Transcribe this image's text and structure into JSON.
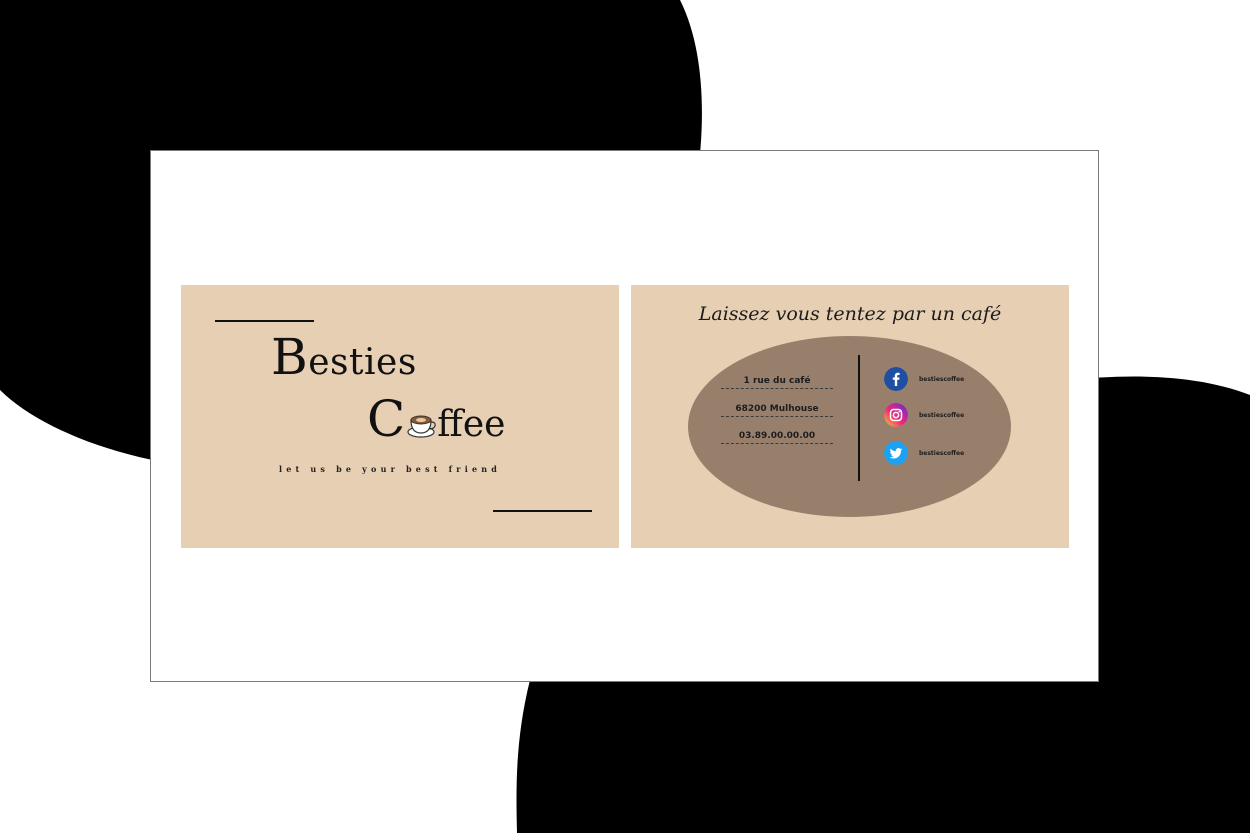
{
  "front": {
    "brand_first_cap": "B",
    "brand_first_rest": "esties",
    "brand_second_cap": "C",
    "brand_second_rest": "ffee",
    "tagline": "let us be your best friend"
  },
  "back": {
    "slogan": "Laissez vous tentez par un café",
    "address": [
      "1 rue du café",
      "68200 Mulhouse",
      "03.89.00.00.00"
    ],
    "socials": [
      {
        "icon": "facebook-icon",
        "handle": "bestiescoffee"
      },
      {
        "icon": "instagram-icon",
        "handle": "bestiescoffee"
      },
      {
        "icon": "twitter-icon",
        "handle": "bestiescoffee"
      }
    ]
  },
  "colors": {
    "card": "#e6cfb3",
    "ellipse": "#987f6c",
    "ink": "#111111",
    "facebook": "#1f4fa3",
    "twitter": "#1da1f2"
  }
}
